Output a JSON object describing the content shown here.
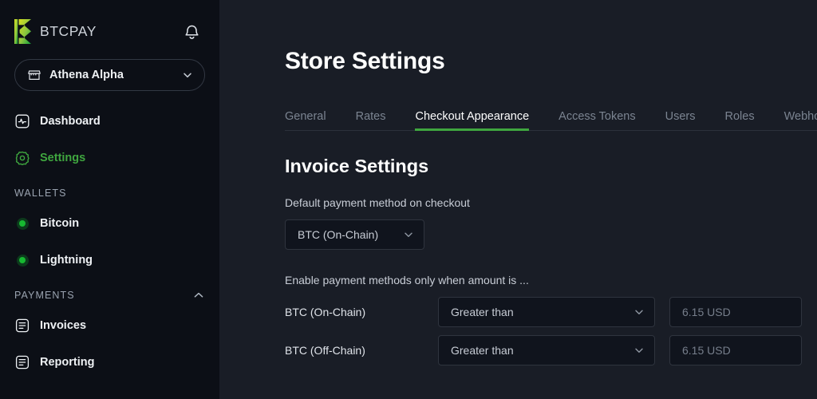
{
  "sidebar": {
    "brand": {
      "name": "BTCPAY",
      "logo_icon": "btcpay-logo-icon"
    },
    "notifications_icon": "bell-icon",
    "store_selector": {
      "icon": "store-icon",
      "name": "Athena Alpha",
      "chevron_icon": "chevron-down-icon"
    },
    "nav": [
      {
        "label": "Dashboard",
        "icon": "dashboard-icon",
        "active": false
      },
      {
        "label": "Settings",
        "icon": "gear-icon",
        "active": true
      }
    ],
    "wallets_section": {
      "title": "WALLETS",
      "items": [
        {
          "label": "Bitcoin",
          "icon": "status-dot-icon",
          "status_color": "#17b831"
        },
        {
          "label": "Lightning",
          "icon": "status-dot-icon",
          "status_color": "#17b831"
        }
      ]
    },
    "payments_section": {
      "title": "PAYMENTS",
      "collapse_icon": "chevron-up-icon",
      "items": [
        {
          "label": "Invoices",
          "icon": "invoice-icon"
        },
        {
          "label": "Reporting",
          "icon": "report-icon"
        }
      ]
    }
  },
  "main": {
    "page_title": "Store Settings",
    "tabs": [
      {
        "label": "General",
        "active": false
      },
      {
        "label": "Rates",
        "active": false
      },
      {
        "label": "Checkout Appearance",
        "active": true
      },
      {
        "label": "Access Tokens",
        "active": false
      },
      {
        "label": "Users",
        "active": false
      },
      {
        "label": "Roles",
        "active": false
      },
      {
        "label": "Webhooks",
        "active": false
      }
    ],
    "invoice_settings": {
      "section_title": "Invoice Settings",
      "default_payment_method": {
        "label": "Default payment method on checkout",
        "value": "BTC (On-Chain)",
        "chevron_icon": "chevron-down-icon"
      },
      "enable_hint": "Enable payment methods only when amount is ...",
      "rows": [
        {
          "name": "BTC (On-Chain)",
          "comparison": "Greater than",
          "amount_placeholder": "6.15 USD",
          "chevron_icon": "chevron-down-icon"
        },
        {
          "name": "BTC (Off-Chain)",
          "comparison": "Greater than",
          "amount_placeholder": "6.15 USD",
          "chevron_icon": "chevron-down-icon"
        }
      ]
    }
  },
  "colors": {
    "accent_green": "#3fa63f",
    "sidebar_bg": "#0c0f16",
    "main_bg": "#191d26",
    "status_green": "#17b831"
  }
}
